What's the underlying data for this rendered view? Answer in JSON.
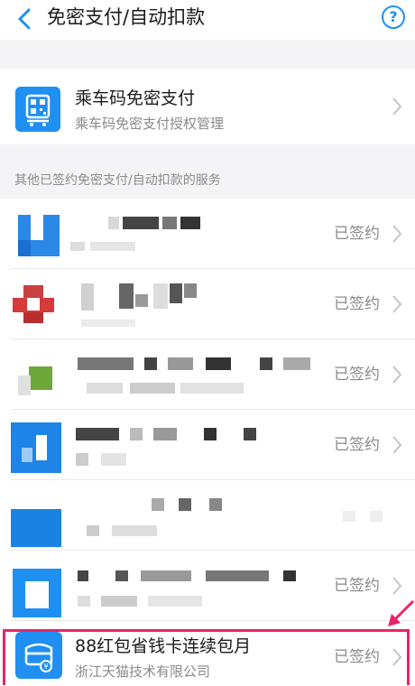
{
  "header": {
    "title": "免密支付/自动扣款",
    "back_icon": "back-chevron-icon",
    "help_icon": "help-circle-icon",
    "help_glyph": "?"
  },
  "featured": {
    "title": "乘车码免密支付",
    "subtitle": "乘车码免密支付授权管理",
    "icon": "bus-qr-icon"
  },
  "section_label": "其他已签约免密支付/自动扣款的服务",
  "services": [
    {
      "status": "已签约"
    },
    {
      "status": "已签约"
    },
    {
      "status": "已签约"
    },
    {
      "status": "已签约"
    },
    {
      "status": ""
    },
    {
      "status": "已签约"
    }
  ],
  "highlight": {
    "title": "88红包省钱卡连续包月",
    "subtitle": "浙江天猫技术有限公司",
    "status": "已签约",
    "icon": "tmall-yuan-icon"
  },
  "colors": {
    "accent": "#1f8ff2",
    "highlight_border": "#e8246a",
    "status_text": "#8a8a8a"
  }
}
